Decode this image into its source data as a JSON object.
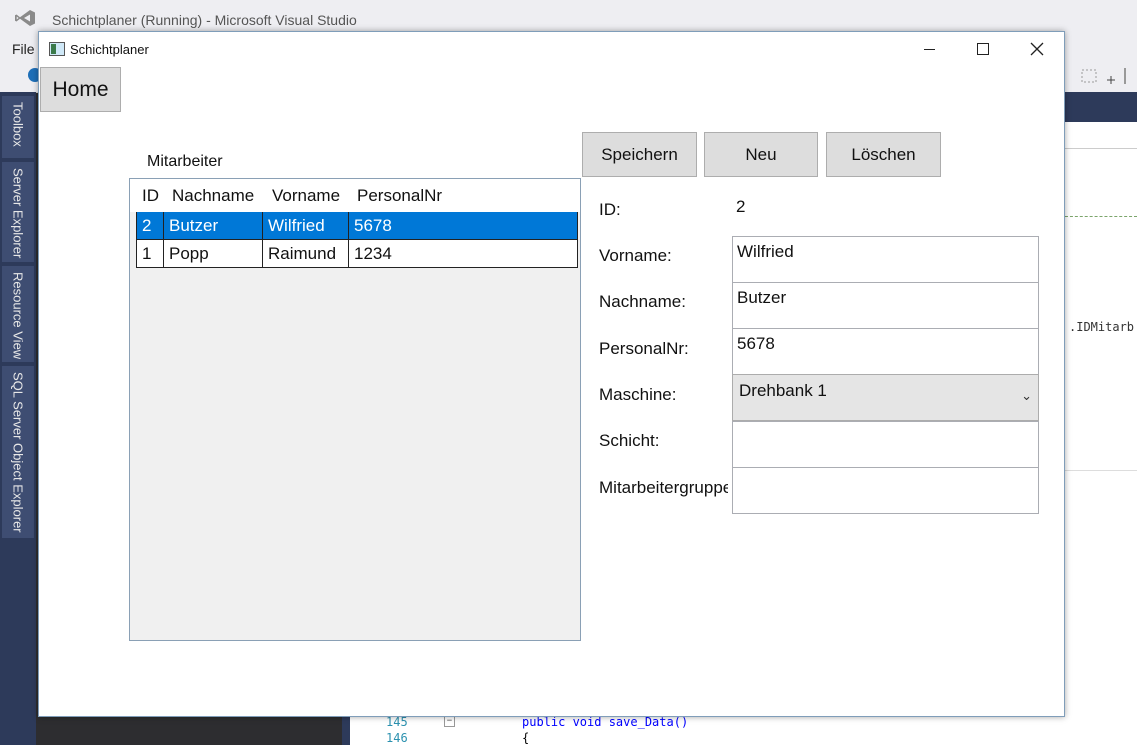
{
  "vs": {
    "title": "Schichtplaner (Running) - Microsoft Visual Studio",
    "menu_file": "File",
    "side_tabs": [
      "Toolbox",
      "Server Explorer",
      "Resource View",
      "SQL Server Object Explorer"
    ],
    "editor_snippet": ".IDMitarb",
    "code_lines": [
      {
        "num": "145",
        "text": "public void save_Data()"
      },
      {
        "num": "146",
        "text": "{"
      }
    ]
  },
  "app": {
    "title": "Schichtplaner",
    "home_label": "Home",
    "employees_label": "Mitarbeiter",
    "buttons": {
      "save": "Speichern",
      "new": "Neu",
      "delete": "Löschen"
    },
    "grid": {
      "columns": [
        "ID",
        "Nachname",
        "Vorname",
        "PersonalNr"
      ],
      "rows": [
        {
          "id": "2",
          "nachname": "Butzer",
          "vorname": "Wilfried",
          "personalnr": "5678",
          "selected": true
        },
        {
          "id": "1",
          "nachname": "Popp",
          "vorname": "Raimund",
          "personalnr": "1234",
          "selected": false
        }
      ]
    },
    "form": {
      "id_label": "ID:",
      "id_value": "2",
      "vorname_label": "Vorname:",
      "vorname_value": "Wilfried",
      "nachname_label": "Nachname:",
      "nachname_value": "Butzer",
      "personalnr_label": "PersonalNr:",
      "personalnr_value": "5678",
      "maschine_label": "Maschine:",
      "maschine_value": "Drehbank 1",
      "schicht_label": "Schicht:",
      "schicht_value": "",
      "gruppe_label": "Mitarbeitergruppe:",
      "gruppe_value": ""
    }
  },
  "colors": {
    "selection": "#0078d7",
    "vs_dark": "#2d3a5a",
    "button_face": "#dddddd"
  },
  "icons": [
    "visual-studio-logo-icon",
    "app-window-icon",
    "minimize-icon",
    "maximize-icon",
    "close-icon",
    "chevron-down-icon"
  ]
}
